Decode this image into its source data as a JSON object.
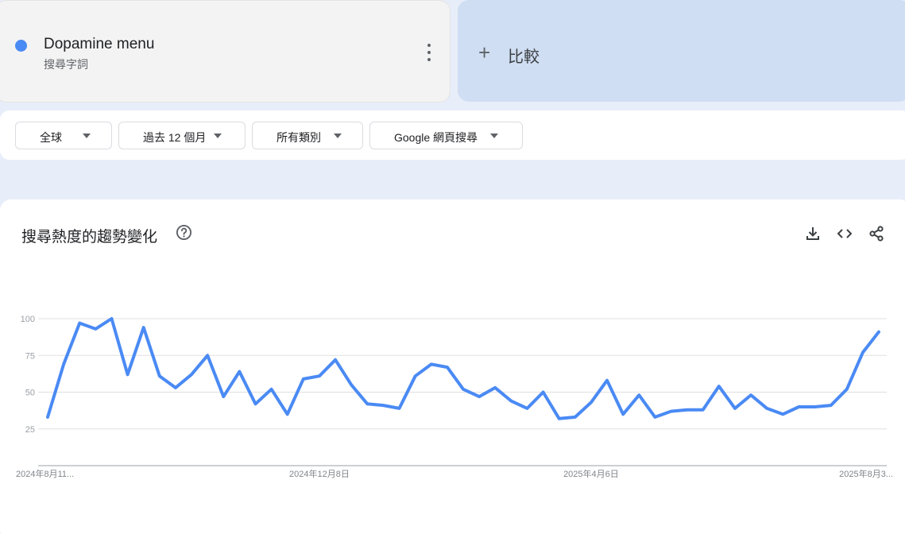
{
  "term": {
    "name": "Dopamine menu",
    "subtitle": "搜尋字詞",
    "color": "#4a8af4"
  },
  "compare": {
    "label": "比較"
  },
  "filters": [
    {
      "label": "全球"
    },
    {
      "label": "過去 12 個月"
    },
    {
      "label": "所有類別"
    },
    {
      "label": "Google 網頁搜尋"
    }
  ],
  "chart_panel": {
    "title": "搜尋熱度的趨勢變化",
    "icons": [
      "help-icon",
      "download-icon",
      "embed-icon",
      "share-icon"
    ]
  },
  "chart_data": {
    "type": "line",
    "title": "",
    "xlabel": "",
    "ylabel": "",
    "ylim": [
      0,
      100
    ],
    "y_ticks": [
      25,
      50,
      75,
      100
    ],
    "grid": true,
    "x_tick_labels": [
      "2024年8月11...",
      "2024年12月8日",
      "2025年4月6日",
      "2025年8月3..."
    ],
    "x_tick_indices": [
      0,
      17,
      34,
      51
    ],
    "series": [
      {
        "color": "#4a8af4",
        "values": [
          33,
          69,
          97,
          93,
          100,
          62,
          94,
          61,
          53,
          62,
          75,
          47,
          64,
          42,
          52,
          35,
          59,
          61,
          72,
          55,
          42,
          41,
          39,
          61,
          69,
          67,
          52,
          47,
          53,
          44,
          39,
          50,
          32,
          33,
          43,
          58,
          35,
          48,
          33,
          37,
          38,
          38,
          54,
          39,
          48,
          39,
          35,
          40,
          40,
          41,
          52,
          77,
          91
        ]
      }
    ]
  }
}
